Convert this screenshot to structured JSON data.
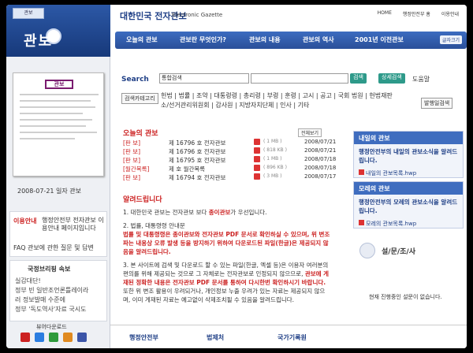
{
  "left": {
    "logo_title": "관보",
    "magazine_label": "관보",
    "paper_title": "관보",
    "date": "2008-07-21 일자 관보",
    "info_title": "이용안내",
    "info_text": "행정안전부 전자관보 이용안내 페이지입니다",
    "faq": "FAQ  관보에 관한 질문 및 답변",
    "info_block_title": "국정브리핑 속보",
    "info_block_lines": [
      "실감대단!",
      "정부 빈 일반조언론틀레이라",
      "러 정보발매 수준에",
      "정부 '독도역사'자료 국시도"
    ],
    "viewer_label": "뷰어다운로드"
  },
  "header": {
    "site_title": "대한민국 전자관보",
    "site_sub": "Electronic Gazette",
    "toplinks": [
      "HOME",
      "행정안전부 홈",
      "이용안내"
    ],
    "nav": [
      "오늘의 관보",
      "관보란 무엇인가?",
      "관보의 내용",
      "관보의 역사",
      "2001년 이전관보"
    ],
    "font_size_label": "글자크기"
  },
  "search": {
    "label": "Search",
    "select_value": "통합검색",
    "search_btn": "검색",
    "detail_btn": "상세검색",
    "help": "도움말",
    "category_label": "검색카테고리",
    "categories": "헌법 | 법률 | 조약 | 대통령령 | 총리령 | 부령 | 훈령 | 고시 | 공고 | 국회 법원 | 헌법재판소/선거관리위원회 | 감사원 | 지방자치단체 | 인사 | 기타",
    "issue_btn": "발행일검색"
  },
  "today": {
    "title": "오늘의 관보",
    "more": "전체보기",
    "rows": [
      {
        "tag": "[판    보]",
        "no": "제 16796 호  전자관보",
        "size": "( 1 MB )",
        "date": "2008/07/21"
      },
      {
        "tag": "[판    보]",
        "no": "제 16796 호  전자관보",
        "size": "( 818 KB )",
        "date": "2008/07/21"
      },
      {
        "tag": "[판    보]",
        "no": "제 16795 호  전자관보",
        "size": "( 1 MB )",
        "date": "2008/07/18"
      },
      {
        "tag": "[월간목록]",
        "no": "제 호  월간목록",
        "size": "( 896 KB )",
        "date": "2008/07/18"
      },
      {
        "tag": "[판    보]",
        "no": "제 16794 호  전자관보",
        "size": "( 3 MB )",
        "date": "2008/07/17"
      }
    ]
  },
  "notice": {
    "title": "알려드립니다",
    "p1_a": "1. 대한민국 관보는 전자관보 보다 ",
    "p1_b": "종이관보",
    "p1_c": "가 우선입니다.",
    "p2_a": "2. 법률, 대통령령 안내문",
    "p2_b": "법률 및 대통령령은 종이관보와 전자관보 PDF 문서로 확인하실 수 있으며, 위 변조 파는 내용상 오류 발생 등을 방지하기 위하여 다운로드된 파일(한글)은 제공되지 않음을 알려드립니다.",
    "p3_a": "3. 본 사이트에 검색 및 다운로드 할 수 있는 파일(한글, 엑셀 등)은 이용자 여러분의 편의를 위해 제공되는 것으로 그 자체로는 전자관보로 인정되지 않으므로, ",
    "p3_b": "관보에 게재된 정확한 내용은 전자관보 PDF 문서를 통하여 다시한번 확인하시기 바랍니다.",
    "p3_c": "또한 위 변조 활용이 우려되거나, 개인정보 누출 우려가 있는 자료는 제공되지 않으며, 이미 게재된 자료는 예고없이 삭제조치될 수 있음을 알려드립니다."
  },
  "right": {
    "tomorrow_title": "내일의 관보",
    "tomorrow_text": "행정안전부의 내일의 관보소식을 알려드립니다.",
    "tomorrow_link": "내일의 관보목록.hwp",
    "dayafter_title": "모레의 관보",
    "dayafter_text": "행정안전부의 모레의 관보소식을 알려드립니다.",
    "dayafter_link": "모레의 관보목록.hwp",
    "survey_title": "설/문/조/사",
    "survey_text": "현재 진행중인 설문이 없습니다."
  },
  "footer": {
    "items": [
      "행정안전부",
      "법제처",
      "국가기록원"
    ]
  }
}
